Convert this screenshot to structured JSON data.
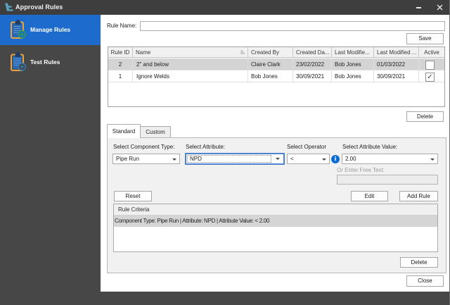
{
  "window": {
    "title": "Approval Rules"
  },
  "sidebar": {
    "items": [
      {
        "label": "Manage Rules"
      },
      {
        "label": "Test Rules"
      }
    ]
  },
  "form": {
    "rule_name_label": "Rule Name:",
    "rule_name_value": "",
    "save_label": "Save",
    "delete_label": "Delete",
    "close_label": "Close"
  },
  "table": {
    "columns": [
      "Rule ID",
      "Name",
      "Created By",
      "Created Da...",
      "Last Modifie...",
      "Last Modified ...",
      "Active"
    ],
    "rows": [
      {
        "rule_id": "2",
        "name": "2\" and below",
        "created_by": "Claire Clark",
        "created_date": "23/02/2022",
        "last_modified_by": "Bob Jones",
        "last_modified_date": "01/03/2022",
        "active": ""
      },
      {
        "rule_id": "1",
        "name": "Ignore Welds",
        "created_by": "Bob Jones",
        "created_date": "30/09/2021",
        "last_modified_by": "Bob Jones",
        "last_modified_date": "30/09/2021",
        "active": "✓"
      }
    ]
  },
  "tabs": [
    {
      "label": "Standard"
    },
    {
      "label": "Custom"
    }
  ],
  "standard_tab": {
    "component_type_label": "Select Component Type:",
    "component_type_value": "Pipe Run",
    "attribute_label": "Select Attribute:",
    "attribute_value": "NPD",
    "operator_label": "Select Operator",
    "operator_value": "<",
    "attribute_value_label": "Select Attribute Value:",
    "attribute_value_value": "2.00",
    "free_text_label": "Or Enter Free Text:",
    "free_text_value": "",
    "reset_label": "Reset",
    "edit_label": "Edit",
    "add_rule_label": "Add Rule",
    "criteria_header": "Rule Criteria",
    "criteria_rows": [
      "Component Type: Pipe Run | Attribute: NPD | Attribute Value: < 2.00"
    ]
  },
  "icons": {
    "info_glyph": "i"
  },
  "colors": {
    "accent_blue": "#1d6ccd",
    "titlebar": "#3e3e3e",
    "sidebar": "#474747",
    "info_blue": "#0d6cd1",
    "selected_row": "#d4d4d4"
  }
}
